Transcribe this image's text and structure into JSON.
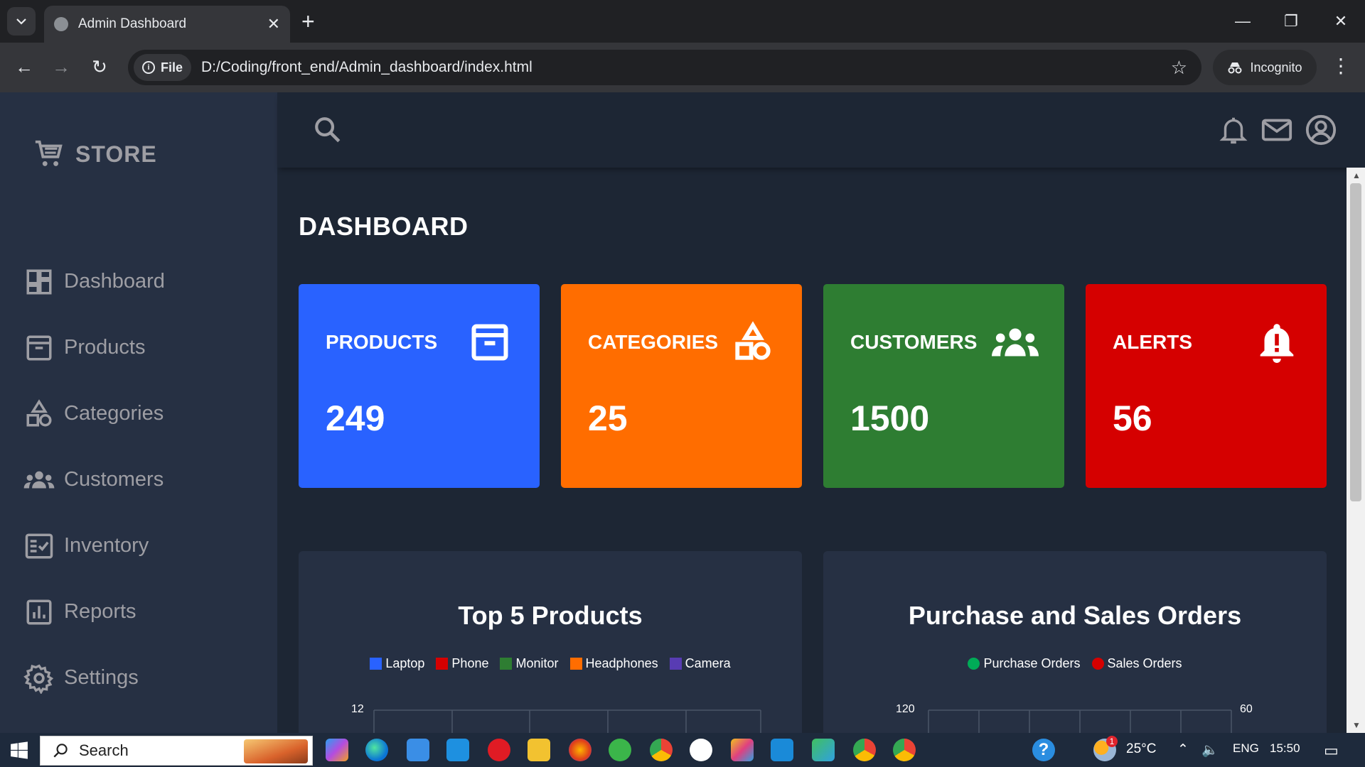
{
  "browser": {
    "tab_title": "Admin Dashboard",
    "url_chip": "File",
    "url": "D:/Coding/front_end/Admin_dashboard/index.html",
    "profile_label": "Incognito"
  },
  "brand": {
    "label": "STORE"
  },
  "sidebar": {
    "items": [
      {
        "label": "Dashboard",
        "icon": "dashboard-icon"
      },
      {
        "label": "Products",
        "icon": "archive-icon"
      },
      {
        "label": "Categories",
        "icon": "shapes-icon"
      },
      {
        "label": "Customers",
        "icon": "groups-icon"
      },
      {
        "label": "Inventory",
        "icon": "fact-check-icon"
      },
      {
        "label": "Reports",
        "icon": "poll-icon"
      },
      {
        "label": "Settings",
        "icon": "gear-icon"
      }
    ]
  },
  "main": {
    "title": "DASHBOARD",
    "cards": [
      {
        "title": "PRODUCTS",
        "value": "249",
        "color": "#2962ff",
        "icon": "archive-icon"
      },
      {
        "title": "CATEGORIES",
        "value": "25",
        "color": "#ff6d00",
        "icon": "shapes-icon"
      },
      {
        "title": "CUSTOMERS",
        "value": "1500",
        "color": "#2e7d32",
        "icon": "groups-icon"
      },
      {
        "title": "ALERTS",
        "value": "56",
        "color": "#d50000",
        "icon": "bell-alert-icon"
      }
    ]
  },
  "charts": {
    "bar": {
      "title": "Top 5 Products",
      "legend": [
        {
          "label": "Laptop",
          "color": "#2962ff"
        },
        {
          "label": "Phone",
          "color": "#d50000"
        },
        {
          "label": "Monitor",
          "color": "#2e7d32"
        },
        {
          "label": "Headphones",
          "color": "#ff6d00"
        },
        {
          "label": "Camera",
          "color": "#583cb3"
        }
      ],
      "y_top_label": "12"
    },
    "area": {
      "title": "Purchase and Sales Orders",
      "legend": [
        {
          "label": "Purchase Orders",
          "color": "#00ab57"
        },
        {
          "label": "Sales Orders",
          "color": "#d50000"
        }
      ],
      "y_left_top": "120",
      "y_right_top": "60"
    }
  },
  "taskbar": {
    "search_label": "Search",
    "temperature": "25°C",
    "language": "ENG",
    "time": "15:50",
    "weather_badge": "1"
  }
}
